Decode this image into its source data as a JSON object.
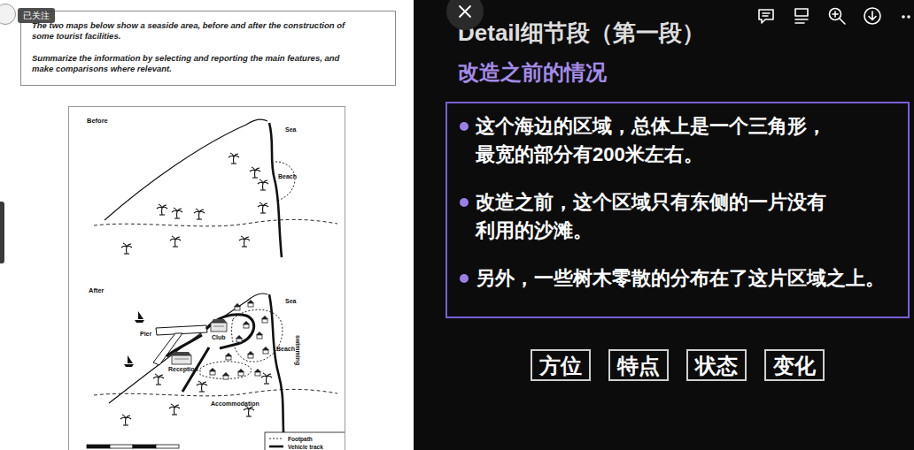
{
  "badge": {
    "text": "已关注"
  },
  "task": {
    "prompt_lines": [
      "The two maps below show a seaside area, before and after the construction of",
      "some tourist facilities."
    ],
    "instruction_lines": [
      "Summarize the information by selecting and reporting the main features, and",
      "make comparisons where relevant."
    ]
  },
  "maps": {
    "before": {
      "title": "Before",
      "sea": "Sea",
      "beach": "Beach"
    },
    "after": {
      "title": "After",
      "sea": "Sea",
      "pier": "Pier",
      "club": "Club",
      "reception": "Reception",
      "beach": "Beach",
      "swimming": "swimming",
      "accommodation": "Accommodation"
    },
    "legend": [
      {
        "label": "Footpath",
        "kind": "footpath"
      },
      {
        "label": "Vehicle track",
        "kind": "vehicle"
      }
    ]
  },
  "slide": {
    "title": "Detail细节段（第一段）",
    "subtitle": "改造之前的情况",
    "bullets": [
      {
        "lines": [
          "这个海边的区域，总体上是一个三角形，",
          "最宽的部分有200米左右。"
        ]
      },
      {
        "lines": [
          "改造之前，这个区域只有东侧的一片没有",
          "利用的沙滩。"
        ]
      },
      {
        "lines": [
          "另外，一些树木零散的分布在了这片区域之上。"
        ]
      }
    ],
    "tags": [
      "方位",
      "特点",
      "状态",
      "变化"
    ]
  }
}
